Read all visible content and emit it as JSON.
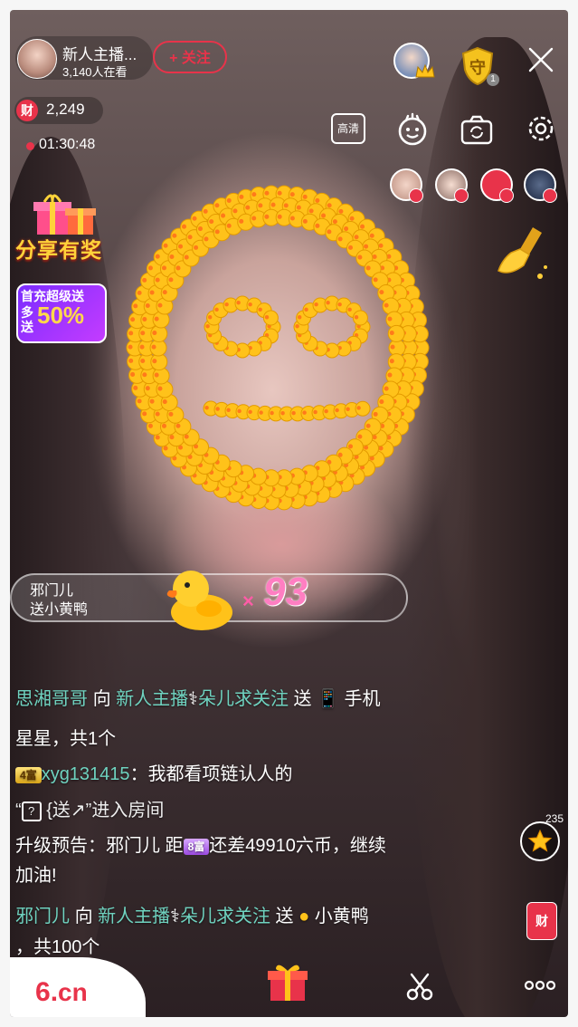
{
  "header": {
    "anchor_name": "新人主播...",
    "viewers": "3,140人在看",
    "follow_label": "+ 关注",
    "wealth_badge": "财",
    "wealth_count": "2,249",
    "live_time": "01:30:48",
    "guard_badge": "守",
    "guard_count": "1",
    "hd_label": "高清"
  },
  "promos": {
    "share": "分享有奖",
    "recharge_top": "首充超级送",
    "recharge_side": "多送",
    "recharge_big": "50%"
  },
  "gift_banner": {
    "sender": "邪门儿",
    "text": "送小黄鸭",
    "times": "×",
    "count": "93"
  },
  "chat": [
    {
      "user": "思湘哥哥",
      "verb": "向",
      "target": "新人主播",
      "target2": "朵儿求关注",
      "send": "送",
      "gift": "手机"
    },
    {
      "cont": "星星，共1个"
    },
    {
      "level": "4富",
      "user": "xyg131415",
      "sep": "：",
      "msg": "我都看项链认人的"
    },
    {
      "quote_open": "“",
      "icon": "?",
      "quote_rest": "{送↗”进入房间"
    },
    {
      "prefix": "升级预告：邪门儿 距",
      "level": "8富",
      "suffix": "还差49910六币，继续"
    },
    {
      "cont": "加油!"
    },
    {
      "user": "邪门儿",
      "verb": "向",
      "target": "新人主播",
      "target2": "朵儿求关注",
      "send": "送",
      "gift": "小黄鸭"
    },
    {
      "cont": "，共100个"
    }
  ],
  "side": {
    "star_count": "235",
    "cai_label": "财"
  },
  "bottom": {
    "logo_six": "6",
    "logo_dot": ".",
    "logo_cn": "cn"
  },
  "colors": {
    "accent": "#e8334a",
    "username": "#6fd3c0",
    "duck": "#ffc21a"
  }
}
